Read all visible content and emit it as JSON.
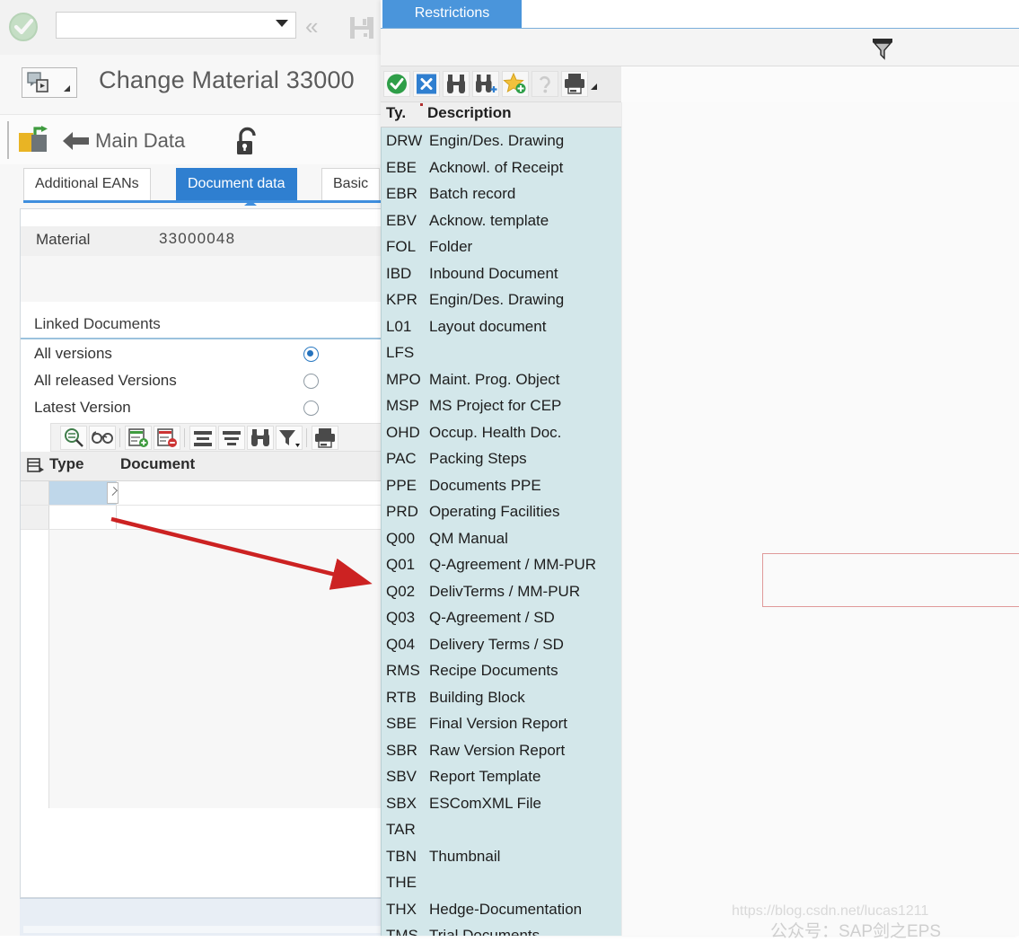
{
  "system_toolbar": {
    "ok_icon": "green-check-icon",
    "command_field_value": "",
    "command_field_placeholder": "",
    "collapse_label": "«",
    "save_icon": "save-disk-icon"
  },
  "title_bar": {
    "title": "Change Material 33000",
    "menu_icon": "screen-variant-icon"
  },
  "app_toolbar": {
    "exit_icon": "exit-green-arrow-icon",
    "back_icon": "back-arrow-icon",
    "main_data_label": "Main Data",
    "lock_icon": "open-lock-icon"
  },
  "tabs": [
    {
      "label": "Additional EANs",
      "active": false
    },
    {
      "label": "Document data",
      "active": true
    },
    {
      "label": "Basic",
      "active": false
    }
  ],
  "form": {
    "material_label": "Material",
    "material_value": "33000048",
    "linked_documents_title": "Linked Documents",
    "radios": [
      {
        "label": "All versions",
        "selected": true
      },
      {
        "label": "All released Versions",
        "selected": false
      },
      {
        "label": "Latest Version",
        "selected": false
      }
    ]
  },
  "grid": {
    "toolbar_icons": [
      "detail-search-icon",
      "display-glasses-icon",
      "insert-row-icon",
      "delete-row-icon",
      "sort-ascending-icon",
      "sort-descending-icon",
      "find-binoculars-icon",
      "filter-icon",
      "print-icon"
    ],
    "corner_icon": "select-all-icon",
    "columns": [
      "Type",
      "Document"
    ],
    "rows": [
      {
        "type": "",
        "document": "",
        "selected": true
      },
      {
        "type": "",
        "document": "",
        "selected": false
      }
    ]
  },
  "popup": {
    "tab_label": "Restrictions",
    "filter_icon": "filter-funnel-icon",
    "toolbar_icons": [
      "confirm-green-check-icon",
      "cancel-blue-x-icon",
      "find-binoculars-icon",
      "find-next-binoculars-icon",
      "add-favorite-star-icon",
      "help-icon",
      "print-icon"
    ],
    "list_header": {
      "code": "Ty.",
      "description": "Description"
    },
    "list_rows": [
      {
        "code": "DRW",
        "description": "Engin/Des. Drawing"
      },
      {
        "code": "EBE",
        "description": "Acknowl. of Receipt"
      },
      {
        "code": "EBR",
        "description": "Batch record"
      },
      {
        "code": "EBV",
        "description": "Acknow. template"
      },
      {
        "code": "FOL",
        "description": "Folder"
      },
      {
        "code": "IBD",
        "description": "Inbound Document"
      },
      {
        "code": "KPR",
        "description": "Engin/Des. Drawing"
      },
      {
        "code": "L01",
        "description": "Layout document"
      },
      {
        "code": "LFS",
        "description": ""
      },
      {
        "code": "MPO",
        "description": "Maint. Prog. Object"
      },
      {
        "code": "MSP",
        "description": "MS Project for CEP"
      },
      {
        "code": "OHD",
        "description": "Occup. Health Doc."
      },
      {
        "code": "PAC",
        "description": "Packing Steps"
      },
      {
        "code": "PPE",
        "description": "Documents PPE"
      },
      {
        "code": "PRD",
        "description": "Operating Facilities"
      },
      {
        "code": "Q00",
        "description": "QM Manual"
      },
      {
        "code": "Q01",
        "description": "Q-Agreement / MM-PUR"
      },
      {
        "code": "Q02",
        "description": "DelivTerms / MM-PUR"
      },
      {
        "code": "Q03",
        "description": "Q-Agreement / SD"
      },
      {
        "code": "Q04",
        "description": "Delivery Terms / SD"
      },
      {
        "code": "RMS",
        "description": "Recipe Documents"
      },
      {
        "code": "RTB",
        "description": "Building Block"
      },
      {
        "code": "SBE",
        "description": "Final Version Report"
      },
      {
        "code": "SBR",
        "description": "Raw Version Report"
      },
      {
        "code": "SBV",
        "description": "Report Template"
      },
      {
        "code": "SBX",
        "description": "ESComXML File"
      },
      {
        "code": "TAR",
        "description": ""
      },
      {
        "code": "TBN",
        "description": "Thumbnail"
      },
      {
        "code": "THE",
        "description": ""
      },
      {
        "code": "THX",
        "description": "Hedge-Documentation"
      },
      {
        "code": "TMS",
        "description": "Trial Documents"
      }
    ]
  },
  "annotations": {
    "highlight_rows": [
      "Q01",
      "Q02"
    ],
    "highlight_color": "#e09a9a",
    "arrow_color": "#cc2222"
  },
  "watermark": {
    "url": "https://blog.csdn.net/lucas1211",
    "name": "公众号：SAP剑之EPS"
  },
  "colors": {
    "accent_blue": "#2f7fd0",
    "tab_blue": "#4a95db",
    "list_bg": "#d3e7ea",
    "selected_cell": "#bfd7ea"
  }
}
